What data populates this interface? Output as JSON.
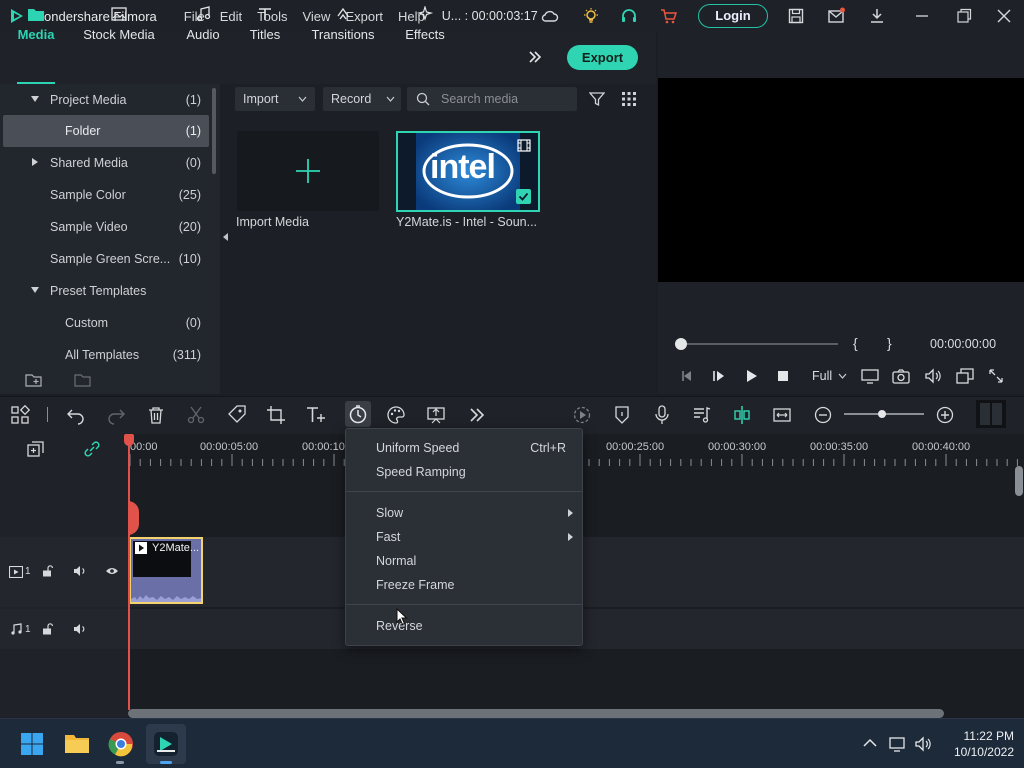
{
  "titlebar": {
    "app_title": "Wondershare Filmora",
    "menu": [
      "File",
      "Edit",
      "Tools",
      "View",
      "Export",
      "Help"
    ],
    "project_time": "U... : 00:00:03:17",
    "login_label": "Login"
  },
  "media_tabs": [
    {
      "label": "Media"
    },
    {
      "label": "Stock Media"
    },
    {
      "label": "Audio"
    },
    {
      "label": "Titles"
    },
    {
      "label": "Transitions"
    },
    {
      "label": "Effects"
    }
  ],
  "export_label": "Export",
  "tree": [
    {
      "label": "Project Media",
      "count": "(1)"
    },
    {
      "label": "Folder",
      "count": "(1)"
    },
    {
      "label": "Shared Media",
      "count": "(0)"
    },
    {
      "label": "Sample Color",
      "count": "(25)"
    },
    {
      "label": "Sample Video",
      "count": "(20)"
    },
    {
      "label": "Sample Green Scre...",
      "count": "(10)"
    },
    {
      "label": "Preset Templates",
      "count": ""
    },
    {
      "label": "Custom",
      "count": "(0)"
    },
    {
      "label": "All Templates",
      "count": "(311)"
    }
  ],
  "media_toolbar": {
    "import_label": "Import",
    "record_label": "Record",
    "search_placeholder": "Search media"
  },
  "media_items": {
    "import_label": "Import Media",
    "clip_name": "Y2Mate.is - Intel - Soun...",
    "thumb_text": "intel"
  },
  "preview": {
    "brace_left": "{",
    "brace_right": "}",
    "timecode": "00:00:00:00",
    "quality": "Full"
  },
  "ruler_ticks": [
    "00:00",
    "00:00:05:00",
    "00:00:10",
    "00:00:25:00",
    "00:00:30:00",
    "00:00:35:00",
    "00:00:40:00"
  ],
  "tracks": {
    "video_num": "1",
    "audio_num": "1",
    "clip_label": "Y2Mate..."
  },
  "context_menu": {
    "uniform_speed": "Uniform Speed",
    "uniform_shortcut": "Ctrl+R",
    "speed_ramping": "Speed Ramping",
    "slow": "Slow",
    "fast": "Fast",
    "normal": "Normal",
    "freeze_frame": "Freeze Frame",
    "reverse": "Reverse"
  },
  "taskbar": {
    "time": "11:22 PM",
    "date": "10/10/2022"
  },
  "colors": {
    "accent": "#2fd5b3",
    "playhead": "#e0524a",
    "clip_border": "#f4d26e"
  }
}
